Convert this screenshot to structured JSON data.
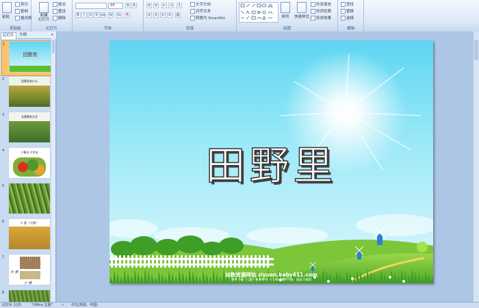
{
  "ribbon": {
    "clipboard": {
      "label": "剪贴板",
      "paste": "粘贴",
      "cut": "剪切",
      "copy": "复制",
      "format_painter": "格式刷"
    },
    "slides": {
      "label": "幻灯片",
      "new_slide": "新建\n幻灯片",
      "layout": "版式",
      "reset": "重设",
      "delete": "删除"
    },
    "font": {
      "label": "字体",
      "font_size": "96",
      "bold": "B",
      "italic": "I",
      "underline": "U",
      "shadow": "S",
      "strike": "abe",
      "spacing": "AV",
      "case": "Aa",
      "color": "A"
    },
    "paragraph": {
      "label": "段落",
      "text_direction": "文字方向",
      "align_text": "对齐文本",
      "convert_smartart": "转换为 SmartArt"
    },
    "drawing": {
      "label": "绘图",
      "arrange": "排列",
      "quick_styles": "快速样式",
      "shape_fill": "形状填充",
      "shape_outline": "形状轮廓",
      "shape_effects": "形状效果"
    },
    "editing": {
      "label": "编辑",
      "find": "查找",
      "replace": "替换",
      "select": "选择"
    }
  },
  "panel": {
    "tab_slides": "幻灯片",
    "tab_outline": "大纲",
    "slides": [
      {
        "num": "1",
        "title": "田野里"
      },
      {
        "num": "2",
        "title": "田野里有什么"
      },
      {
        "num": "3",
        "title": "金黄黄的大豆"
      },
      {
        "num": "4",
        "title": "小黄瓜 大冬瓜"
      },
      {
        "num": "5",
        "title": ""
      },
      {
        "num": "6",
        "title": "小 麦 （小麦）"
      },
      {
        "num": "7",
        "title": ""
      },
      {
        "num": "8",
        "title": ""
      }
    ],
    "slide7_words": [
      "大 麦",
      "小 麦"
    ]
  },
  "slide": {
    "title": "田野里",
    "footer_line1": "幼教资源网站  ziyuan.baby611.com",
    "footer_line2": "课件下载 · 儿歌 · 故事MP3 · FLASH课件下载 · 动画下载等"
  },
  "status": {
    "slide_count": "幻灯片 1/25",
    "theme": "\"Office 主题\"",
    "language": "中文(简体，中国)"
  },
  "colors": {
    "sky_top": "#5ed6f2",
    "grass": "#5fbe2e",
    "selected_thumb": "#f9c46b",
    "ribbon": "#dce8f6"
  }
}
